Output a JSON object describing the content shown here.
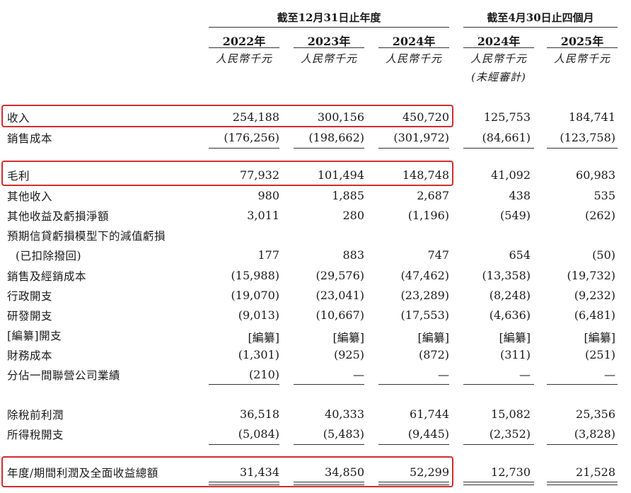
{
  "header": {
    "group1": "截至12月31日止年度",
    "group2": "截至4月30日止四個月",
    "years": [
      "2022年",
      "2023年",
      "2024年",
      "2024年",
      "2025年"
    ],
    "unit": "人民幣千元",
    "unaudited_note": "(未經審計)"
  },
  "rows": [
    {
      "label": "收入",
      "values": [
        "254,188",
        "300,156",
        "450,720",
        "125,753",
        "184,741"
      ],
      "highlight": true
    },
    {
      "label": "銷售成本",
      "values": [
        "(176,256)",
        "(198,662)",
        "(301,972)",
        "(84,661)",
        "(123,758)"
      ]
    },
    {
      "label": "毛利",
      "values": [
        "77,932",
        "101,494",
        "148,748",
        "41,092",
        "60,983"
      ],
      "highlight": true
    },
    {
      "label": "其他收入",
      "values": [
        "980",
        "1,885",
        "2,687",
        "438",
        "535"
      ]
    },
    {
      "label": "其他收益及虧損淨額",
      "values": [
        "3,011",
        "280",
        "(1,196)",
        "(549)",
        "(262)"
      ]
    },
    {
      "label": "預期信貸虧損模型下的減值虧損",
      "values": [
        "",
        "",
        "",
        "",
        ""
      ]
    },
    {
      "label": "(已扣除撥回)",
      "values": [
        "177",
        "883",
        "747",
        "654",
        "(50)"
      ]
    },
    {
      "label": "銷售及經銷成本",
      "values": [
        "(15,988)",
        "(29,576)",
        "(47,462)",
        "(13,358)",
        "(19,732)"
      ]
    },
    {
      "label": "行政開支",
      "values": [
        "(19,070)",
        "(23,041)",
        "(23,289)",
        "(8,248)",
        "(9,232)"
      ]
    },
    {
      "label": "研發開支",
      "values": [
        "(9,013)",
        "(10,667)",
        "(17,553)",
        "(4,636)",
        "(6,481)"
      ]
    },
    {
      "label": "[編纂]開支",
      "values": [
        "[編纂]",
        "[編纂]",
        "[編纂]",
        "[編纂]",
        "[編纂]"
      ]
    },
    {
      "label": "財務成本",
      "values": [
        "(1,301)",
        "(925)",
        "(872)",
        "(311)",
        "(251)"
      ]
    },
    {
      "label": "分佔一間聯營公司業績",
      "values": [
        "(210)",
        "—",
        "—",
        "—",
        "—"
      ]
    },
    {
      "label": "除稅前利潤",
      "values": [
        "36,518",
        "40,333",
        "61,744",
        "15,082",
        "25,356"
      ]
    },
    {
      "label": "所得稅開支",
      "values": [
        "(5,084)",
        "(5,483)",
        "(9,445)",
        "(2,352)",
        "(3,828)"
      ]
    },
    {
      "label": "年度/期間利潤及全面收益總額",
      "values": [
        "31,434",
        "34,850",
        "52,299",
        "12,730",
        "21,528"
      ],
      "highlight": true
    }
  ],
  "colors": {
    "highlight": "#d12d2d",
    "text": "#1a1a1a"
  }
}
